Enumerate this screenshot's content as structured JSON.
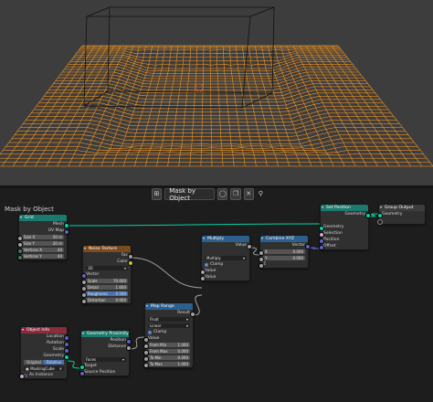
{
  "editor": {
    "tree_name": "Mask by Object",
    "breadcrumb": "Mask by Object"
  },
  "nodes": {
    "grid": {
      "title": "Grid",
      "outputs": [
        "Mesh",
        "UV Map"
      ],
      "fields": [
        {
          "label": "Size X",
          "value": "20 m"
        },
        {
          "label": "Size Y",
          "value": "20 m"
        },
        {
          "label": "Vertices X",
          "value": "40"
        },
        {
          "label": "Vertices Y",
          "value": "40"
        }
      ]
    },
    "noise": {
      "title": "Noise Texture",
      "outputs": [
        "Fac",
        "Color"
      ],
      "dimension": "3D",
      "vector_label": "Vector",
      "fields": [
        {
          "label": "Scale",
          "value": "70.000"
        },
        {
          "label": "Detail",
          "value": "1.600"
        },
        {
          "label": "Roughness",
          "value": "0.500"
        },
        {
          "label": "Distortion",
          "value": "0.000"
        }
      ]
    },
    "multiply": {
      "title": "Multiply",
      "output": "Value",
      "operation": "Multiply",
      "clamp_label": "Clamp",
      "inputs": [
        "Value",
        "Value"
      ]
    },
    "combine": {
      "title": "Combine XYZ",
      "output": "Vector",
      "fields": [
        {
          "label": "X",
          "value": "0.000"
        },
        {
          "label": "Y",
          "value": "0.000"
        }
      ],
      "z_label": "Z"
    },
    "set_position": {
      "title": "Set Position",
      "output": "Geometry",
      "inputs": [
        "Geometry",
        "Selection",
        "Position",
        "Offset"
      ]
    },
    "group_output": {
      "title": "Group Output",
      "input": "Geometry"
    },
    "map_range": {
      "title": "Map Range",
      "output": "Result",
      "data_type": "Float",
      "interpolation": "Linear",
      "clamp_label": "Clamp",
      "value_label": "Value",
      "fields": [
        {
          "label": "From Min",
          "value": "1.000"
        },
        {
          "label": "From Max",
          "value": "0.000"
        },
        {
          "label": "To Min",
          "value": "0.000"
        },
        {
          "label": "To Max",
          "value": "1.000"
        }
      ]
    },
    "object_info": {
      "title": "Object Info",
      "outputs": [
        "Location",
        "Rotation",
        "Scale",
        "Geometry"
      ],
      "modes": [
        "Original",
        "Relative"
      ],
      "object_name": "MaskingCube",
      "as_instance": "As Instance"
    },
    "proximity": {
      "title": "Geometry Proximity",
      "outputs": [
        "Position",
        "Distance"
      ],
      "target_mode": "Faces",
      "inputs": [
        "Target",
        "Source Position"
      ]
    }
  },
  "colors": {
    "viewport_bg": "#3d3d3d",
    "wire": "#ff9a1f",
    "editor_bg": "#1d1d1d",
    "node_body": "#303030",
    "geometry_header": "#1b7a6d",
    "texture_header": "#7a4b1f",
    "utility_header": "#2c5f8c",
    "input_header": "#8c2b3e",
    "geometry_socket": "#00d6a3",
    "float_socket": "#a1a1a1",
    "vector_socket": "#6363c7",
    "selected_field": "#4772b3"
  },
  "icons": [
    "node-tree-icon",
    "shield-icon",
    "copy-icon",
    "close-icon",
    "pin-icon",
    "object-icon"
  ]
}
